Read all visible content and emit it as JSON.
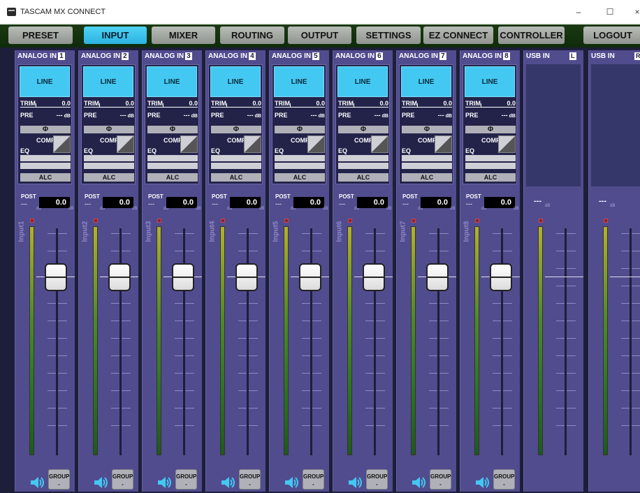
{
  "window": {
    "title": "TASCAM MX CONNECT",
    "minimize": "–",
    "maximize": "☐",
    "close": "×"
  },
  "tabs": [
    {
      "label": "PRESET",
      "active": false
    },
    {
      "label": "INPUT",
      "active": true
    },
    {
      "label": "MIXER",
      "active": false
    },
    {
      "label": "ROUTING",
      "active": false
    },
    {
      "label": "OUTPUT",
      "active": false
    },
    {
      "label": "SETTINGS",
      "active": false
    },
    {
      "label": "EZ CONNECT",
      "active": false
    },
    {
      "label": "CONTROLLER",
      "active": false
    },
    {
      "label": "LOGOUT",
      "active": false
    }
  ],
  "strip_labels": {
    "line": "LINE",
    "trim": "TRIM",
    "pre": "PRE",
    "pre_unit": "dB",
    "phase": "Φ",
    "comp": "COMP",
    "eq": "EQ",
    "alc": "ALC",
    "post": "POST",
    "db": "dB",
    "group": "GROUP"
  },
  "channels": [
    {
      "header": "ANALOG IN",
      "num": "1",
      "name": "Input1",
      "trim": "0.0",
      "pre": "---",
      "post_dash": "---",
      "post_value": "0.0",
      "group_value": "-"
    },
    {
      "header": "ANALOG IN",
      "num": "2",
      "name": "Input2",
      "trim": "0.0",
      "pre": "---",
      "post_dash": "---",
      "post_value": "0.0",
      "group_value": "-"
    },
    {
      "header": "ANALOG IN",
      "num": "3",
      "name": "Input3",
      "trim": "0.0",
      "pre": "---",
      "post_dash": "---",
      "post_value": "0.0",
      "group_value": "-"
    },
    {
      "header": "ANALOG IN",
      "num": "4",
      "name": "Input4",
      "trim": "0.0",
      "pre": "---",
      "post_dash": "---",
      "post_value": "0.0",
      "group_value": "-"
    },
    {
      "header": "ANALOG IN",
      "num": "5",
      "name": "Input5",
      "trim": "0.0",
      "pre": "---",
      "post_dash": "---",
      "post_value": "0.0",
      "group_value": "-"
    },
    {
      "header": "ANALOG IN",
      "num": "6",
      "name": "Input6",
      "trim": "0.0",
      "pre": "---",
      "post_dash": "---",
      "post_value": "0.0",
      "group_value": "-"
    },
    {
      "header": "ANALOG IN",
      "num": "7",
      "name": "Input7",
      "trim": "0.0",
      "pre": "---",
      "post_dash": "---",
      "post_value": "0.0",
      "group_value": "-"
    },
    {
      "header": "ANALOG IN",
      "num": "8",
      "name": "Input8",
      "trim": "0.0",
      "pre": "---",
      "post_dash": "---",
      "post_value": "0.0",
      "group_value": "-"
    }
  ],
  "usb": [
    {
      "header": "USB IN",
      "side": "L",
      "value": "---"
    },
    {
      "header": "USB IN",
      "side": "R",
      "value": "---"
    }
  ],
  "colors": {
    "accent": "#43c8f2",
    "strip": "#514c8e",
    "background": "#1d1f3a",
    "tabbar": "#0f2a0a"
  },
  "icons": {
    "speaker": "speaker-icon",
    "app": "tascam-logo-icon"
  }
}
